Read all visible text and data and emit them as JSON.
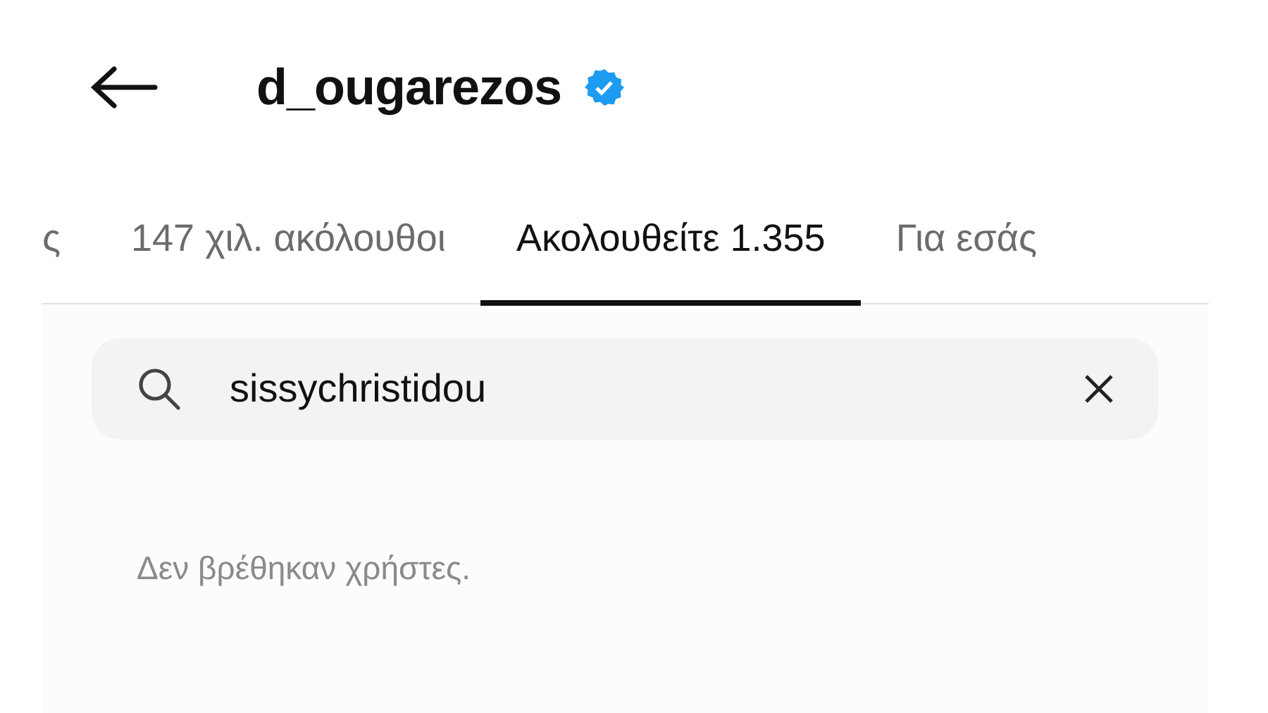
{
  "header": {
    "username": "d_ougarezos",
    "verified": true
  },
  "tabs": [
    {
      "label": "ς",
      "selected": false
    },
    {
      "label": "147 χιλ. ακόλουθοι",
      "selected": false
    },
    {
      "label": "Ακολουθείτε 1.355",
      "selected": true
    },
    {
      "label": "Για εσάς",
      "selected": false
    }
  ],
  "search": {
    "value": "sissychristidou"
  },
  "empty_message": "Δεν βρέθηκαν χρήστες."
}
